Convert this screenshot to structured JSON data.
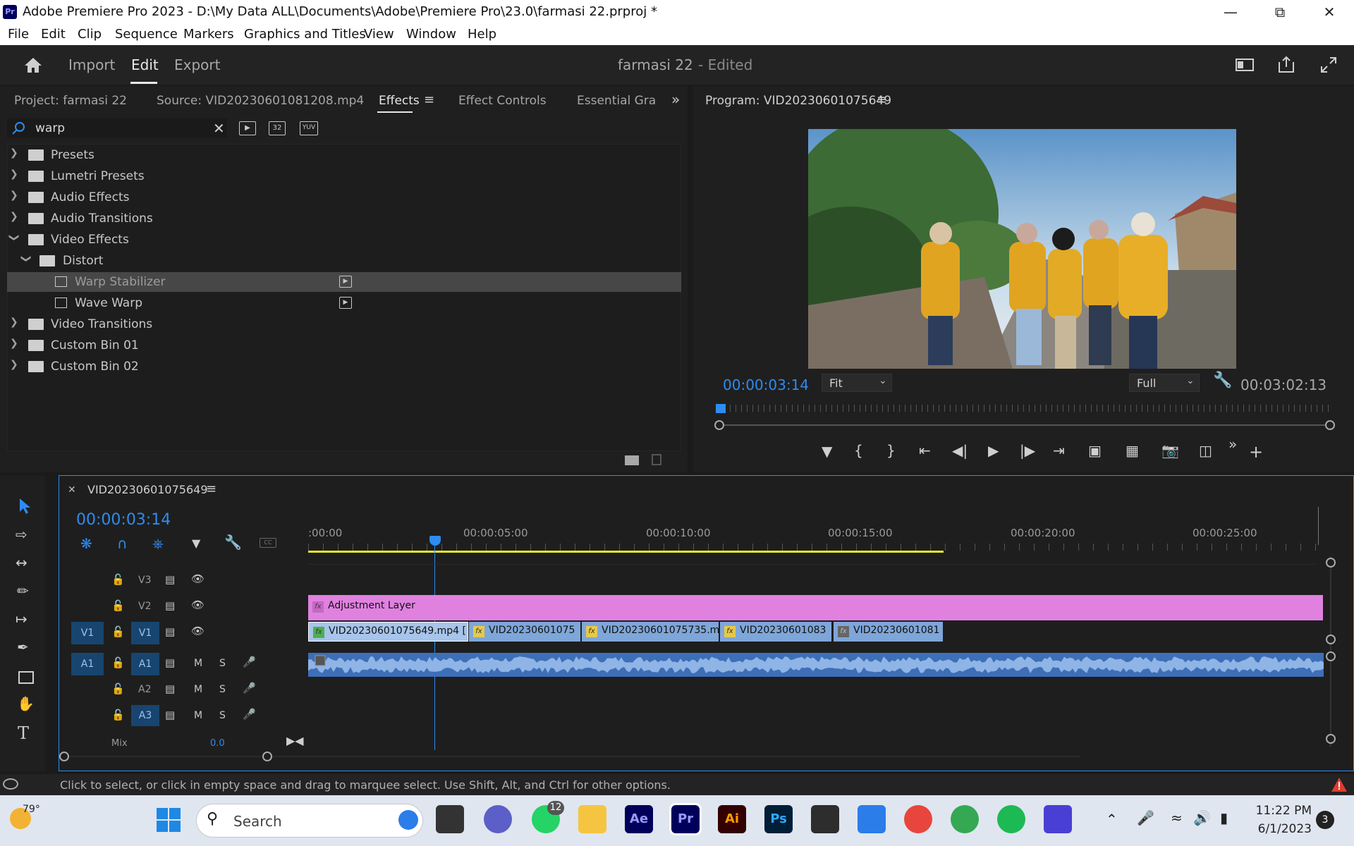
{
  "window": {
    "title": "Adobe Premiere Pro 2023 - D:\\My Data ALL\\Documents\\Adobe\\Premiere Pro\\23.0\\farmasi 22.prproj *",
    "app_badge": "Pr"
  },
  "menu": [
    "File",
    "Edit",
    "Clip",
    "Sequence",
    "Markers",
    "Graphics and Titles",
    "View",
    "Window",
    "Help"
  ],
  "header": {
    "tabs": [
      "Import",
      "Edit",
      "Export"
    ],
    "active_tab": "Edit",
    "project_name": "farmasi 22",
    "project_state": "- Edited"
  },
  "left_panel": {
    "tabs": [
      "Project: farmasi 22",
      "Source: VID20230601081208.mp4",
      "Effects",
      "Effect Controls",
      "Essential Gra"
    ],
    "active_tab": "Effects",
    "search_value": "warp",
    "filter_buttons": [
      "32",
      "YUV"
    ],
    "tree": [
      {
        "label": "Presets",
        "level": 0,
        "expanded": false,
        "type": "preset-bin"
      },
      {
        "label": "Lumetri Presets",
        "level": 0,
        "expanded": false,
        "type": "preset-bin"
      },
      {
        "label": "Audio Effects",
        "level": 0,
        "expanded": false,
        "type": "folder"
      },
      {
        "label": "Audio Transitions",
        "level": 0,
        "expanded": false,
        "type": "folder"
      },
      {
        "label": "Video Effects",
        "level": 0,
        "expanded": true,
        "type": "folder"
      },
      {
        "label": "Distort",
        "level": 1,
        "expanded": true,
        "type": "folder"
      },
      {
        "label": "Warp Stabilizer",
        "level": 2,
        "type": "effect",
        "selected": true,
        "accelerated": true
      },
      {
        "label": "Wave Warp",
        "level": 2,
        "type": "effect",
        "accelerated": true
      },
      {
        "label": "Video Transitions",
        "level": 0,
        "expanded": false,
        "type": "folder"
      },
      {
        "label": "Custom Bin 01",
        "level": 0,
        "expanded": false,
        "type": "folder"
      },
      {
        "label": "Custom Bin 02",
        "level": 0,
        "expanded": false,
        "type": "folder"
      }
    ]
  },
  "program_monitor": {
    "title": "Program: VID20230601075649",
    "timecode_current": "00:00:03:14",
    "timecode_duration": "00:03:02:13",
    "zoom": "Fit",
    "resolution": "Full",
    "playhead_fraction": 0.004
  },
  "timeline": {
    "sequence_name": "VID20230601075649",
    "timecode": "00:00:03:14",
    "ruler": [
      ":00:00",
      "00:00:05:00",
      "00:00:10:00",
      "00:00:15:00",
      "00:00:20:00",
      "00:00:25:00"
    ],
    "video_tracks": [
      {
        "name": "V3",
        "source_patch": ""
      },
      {
        "name": "V2",
        "source_patch": ""
      },
      {
        "name": "V1",
        "source_patch": "V1"
      }
    ],
    "audio_tracks": [
      {
        "name": "A1",
        "source_patch": "A1",
        "m": "M",
        "s": "S"
      },
      {
        "name": "A2",
        "source_patch": "",
        "m": "M",
        "s": "S"
      },
      {
        "name": "A3",
        "source_patch": "",
        "m": "M",
        "s": "S"
      }
    ],
    "mix_label": "Mix",
    "mix_value": "0.0",
    "adjustment_layer": "Adjustment Layer",
    "v1_clips": [
      "VID20230601075649.mp4 [",
      "VID20230601075",
      "VID20230601075735.m",
      "VID20230601083",
      "VID20230601081"
    ],
    "colors": {
      "adjustment": "#e081e0",
      "video_clip": "#7ea6d8",
      "audio": "#5b87c7",
      "playhead": "#2e8cf0",
      "work_area": "#e8e82a"
    }
  },
  "status_bar": {
    "message": "Click to select, or click in empty space and drag to marquee select. Use Shift, Alt, and Ctrl for other options."
  },
  "taskbar": {
    "weather": "79°",
    "search_placeholder": "Search",
    "apps": [
      "Ae",
      "Pr",
      "Ai",
      "Ps"
    ],
    "whatsapp_badge": "12",
    "time": "11:22 PM",
    "date": "6/1/2023",
    "notifications": "3"
  }
}
